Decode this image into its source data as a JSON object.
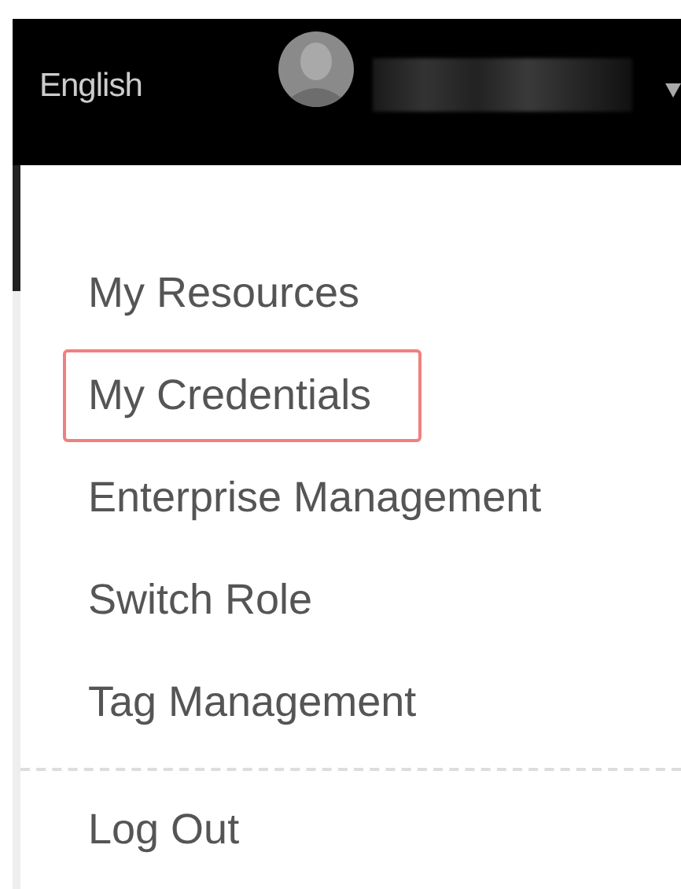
{
  "top_bar": {
    "language": "English"
  },
  "menu": {
    "groups": [
      [
        {
          "label": "My Resources",
          "highlighted": false
        },
        {
          "label": "My Credentials",
          "highlighted": true
        },
        {
          "label": "Enterprise Management",
          "highlighted": false
        },
        {
          "label": "Switch Role",
          "highlighted": false
        },
        {
          "label": "Tag Management",
          "highlighted": false
        }
      ],
      [
        {
          "label": "Log Out",
          "highlighted": false
        }
      ]
    ]
  }
}
